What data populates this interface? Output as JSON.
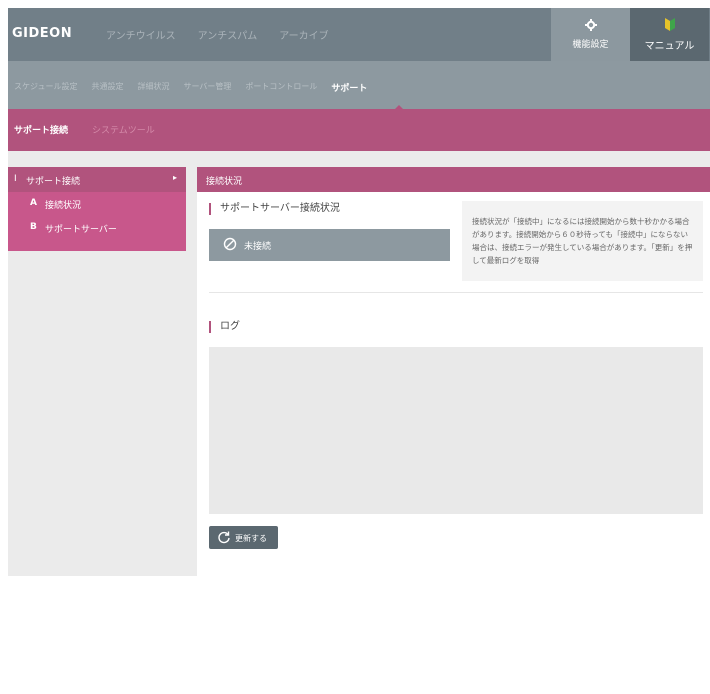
{
  "header": {
    "logo": "GIDEON",
    "nav": [
      "アンチウイルス",
      "アンチスパム",
      "アーカイブ"
    ],
    "settings_label": "機能設定",
    "manual_label": "マニュアル"
  },
  "subnav": {
    "items": [
      "スケジュール設定",
      "共通設定",
      "詳細状況",
      "サーバー管理",
      "ポートコントロール",
      "サポート"
    ],
    "active": "サポート"
  },
  "tabs": {
    "support": "サポート接続",
    "system": "システムツール"
  },
  "sidebar": {
    "parent": {
      "num": "I",
      "label": "サポート接続"
    },
    "children": [
      {
        "num": "A",
        "label": "接続状況"
      },
      {
        "num": "B",
        "label": "サポートサーバー"
      }
    ]
  },
  "panel": {
    "header": "接続状況",
    "server_title": "サポートサーバー接続状況",
    "status": "未接続",
    "info": "接続状況が「接続中」になるには接続開始から数十秒かかる場合があります。接続開始から６０秒待っても「接続中」にならない場合は、接続エラーが発生している場合があります。「更新」を押して最新ログを取得",
    "log_title": "ログ",
    "refresh_label": "更新する"
  },
  "colors": {
    "accent": "#b1537d",
    "topbar": "#717f88",
    "status_bg": "#8d99a0",
    "button": "#5b6870"
  }
}
